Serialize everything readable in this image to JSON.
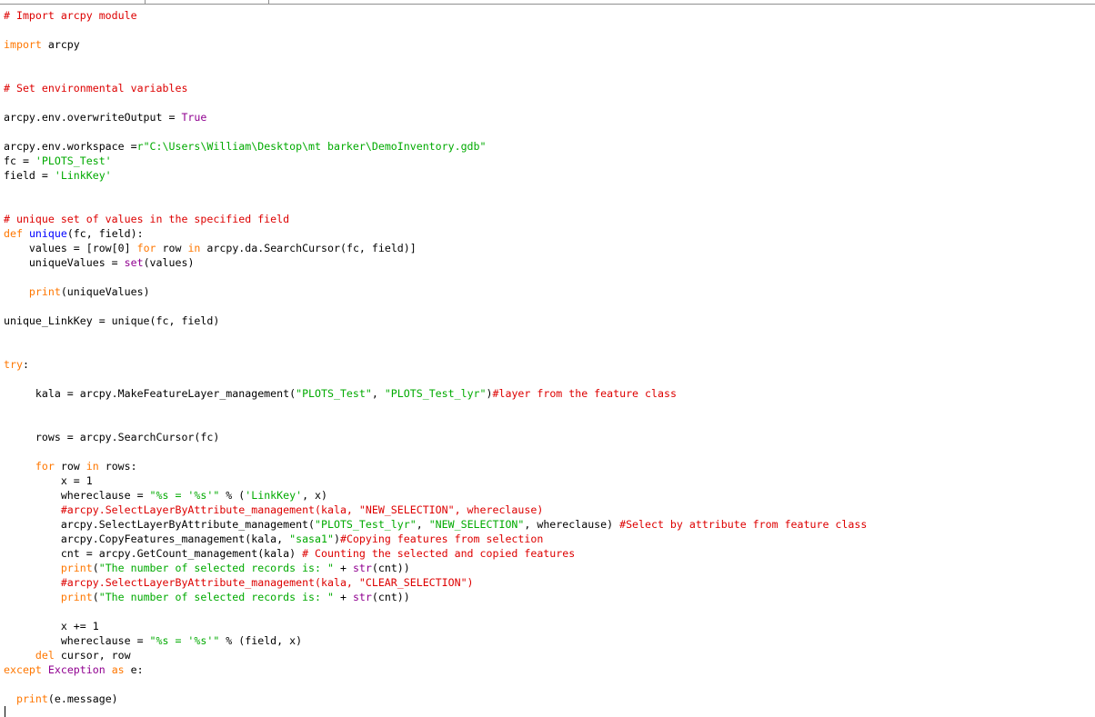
{
  "colors": {
    "keyword": "#ff7700",
    "builtin": "#900090",
    "string": "#00aa00",
    "comment": "#dd0000",
    "definition": "#0000ff",
    "text": "#000000"
  },
  "lines": [
    [
      [
        "cm",
        "# Import arcpy module"
      ]
    ],
    [],
    [
      [
        "kw",
        "import"
      ],
      [
        "",
        " arcpy"
      ]
    ],
    [],
    [],
    [
      [
        "cm",
        "# Set environmental variables"
      ]
    ],
    [],
    [
      [
        "",
        "arcpy.env.overwriteOutput = "
      ],
      [
        "bi",
        "True"
      ]
    ],
    [],
    [
      [
        "",
        "arcpy.env.workspace ="
      ],
      [
        "str",
        "r\"C:\\Users\\William\\Desktop\\mt barker\\DemoInventory.gdb\""
      ]
    ],
    [
      [
        "",
        "fc = "
      ],
      [
        "str",
        "'PLOTS_Test'"
      ]
    ],
    [
      [
        "",
        "field = "
      ],
      [
        "str",
        "'LinkKey'"
      ]
    ],
    [],
    [],
    [
      [
        "cm",
        "# unique set of values in the specified field"
      ]
    ],
    [
      [
        "kw",
        "def"
      ],
      [
        "",
        " "
      ],
      [
        "def",
        "unique"
      ],
      [
        "",
        "(fc, field):"
      ]
    ],
    [
      [
        "",
        "    values = [row[0] "
      ],
      [
        "kw",
        "for"
      ],
      [
        "",
        " row "
      ],
      [
        "kw",
        "in"
      ],
      [
        "",
        " arcpy.da.SearchCursor(fc, field)]"
      ]
    ],
    [
      [
        "",
        "    uniqueValues = "
      ],
      [
        "bi",
        "set"
      ],
      [
        "",
        "(values)"
      ]
    ],
    [],
    [
      [
        "",
        "    "
      ],
      [
        "kw",
        "print"
      ],
      [
        "",
        "(uniqueValues)"
      ]
    ],
    [],
    [
      [
        "",
        "unique_LinkKey = unique(fc, field)"
      ]
    ],
    [],
    [],
    [
      [
        "kw",
        "try"
      ],
      [
        "",
        ":"
      ]
    ],
    [],
    [
      [
        "",
        "     kala = arcpy.MakeFeatureLayer_management("
      ],
      [
        "str",
        "\"PLOTS_Test\""
      ],
      [
        "",
        ", "
      ],
      [
        "str",
        "\"PLOTS_Test_lyr\""
      ],
      [
        "",
        ")"
      ],
      [
        "cm",
        "#layer from the feature class"
      ]
    ],
    [],
    [],
    [
      [
        "",
        "     rows = arcpy.SearchCursor(fc)"
      ]
    ],
    [],
    [
      [
        "",
        "     "
      ],
      [
        "kw",
        "for"
      ],
      [
        "",
        " row "
      ],
      [
        "kw",
        "in"
      ],
      [
        "",
        " rows:"
      ]
    ],
    [
      [
        "",
        "         x = 1"
      ]
    ],
    [
      [
        "",
        "         whereclause = "
      ],
      [
        "str",
        "\"%s = '%s'\""
      ],
      [
        "",
        " % ("
      ],
      [
        "str",
        "'LinkKey'"
      ],
      [
        "",
        ", x)"
      ]
    ],
    [
      [
        "",
        "         "
      ],
      [
        "cm",
        "#arcpy.SelectLayerByAttribute_management(kala, \"NEW_SELECTION\", whereclause)"
      ]
    ],
    [
      [
        "",
        "         arcpy.SelectLayerByAttribute_management("
      ],
      [
        "str",
        "\"PLOTS_Test_lyr\""
      ],
      [
        "",
        ", "
      ],
      [
        "str",
        "\"NEW_SELECTION\""
      ],
      [
        "",
        ", whereclause) "
      ],
      [
        "cm",
        "#Select by attribute from feature class"
      ]
    ],
    [
      [
        "",
        "         arcpy.CopyFeatures_management(kala, "
      ],
      [
        "str",
        "\"sasa1\""
      ],
      [
        "",
        ")"
      ],
      [
        "cm",
        "#Copying features from selection"
      ]
    ],
    [
      [
        "",
        "         cnt = arcpy.GetCount_management(kala) "
      ],
      [
        "cm",
        "# Counting the selected and copied features"
      ]
    ],
    [
      [
        "",
        "         "
      ],
      [
        "kw",
        "print"
      ],
      [
        "",
        "("
      ],
      [
        "str",
        "\"The number of selected records is: \""
      ],
      [
        "",
        " + "
      ],
      [
        "bi",
        "str"
      ],
      [
        "",
        "(cnt))"
      ]
    ],
    [
      [
        "",
        "         "
      ],
      [
        "cm",
        "#arcpy.SelectLayerByAttribute_management(kala, \"CLEAR_SELECTION\")"
      ]
    ],
    [
      [
        "",
        "         "
      ],
      [
        "kw",
        "print"
      ],
      [
        "",
        "("
      ],
      [
        "str",
        "\"The number of selected records is: \""
      ],
      [
        "",
        " + "
      ],
      [
        "bi",
        "str"
      ],
      [
        "",
        "(cnt))"
      ]
    ],
    [],
    [
      [
        "",
        "         x += 1"
      ]
    ],
    [
      [
        "",
        "         whereclause = "
      ],
      [
        "str",
        "\"%s = '%s'\""
      ],
      [
        "",
        " % (field, x)"
      ]
    ],
    [
      [
        "",
        "     "
      ],
      [
        "kw",
        "del"
      ],
      [
        "",
        " cursor, row"
      ]
    ],
    [
      [
        "kw",
        "except"
      ],
      [
        "",
        " "
      ],
      [
        "bi",
        "Exception"
      ],
      [
        "",
        " "
      ],
      [
        "kw",
        "as"
      ],
      [
        "",
        " e:"
      ]
    ],
    [],
    [
      [
        "",
        "  "
      ],
      [
        "kw",
        "print"
      ],
      [
        "",
        "(e.message)"
      ]
    ]
  ]
}
